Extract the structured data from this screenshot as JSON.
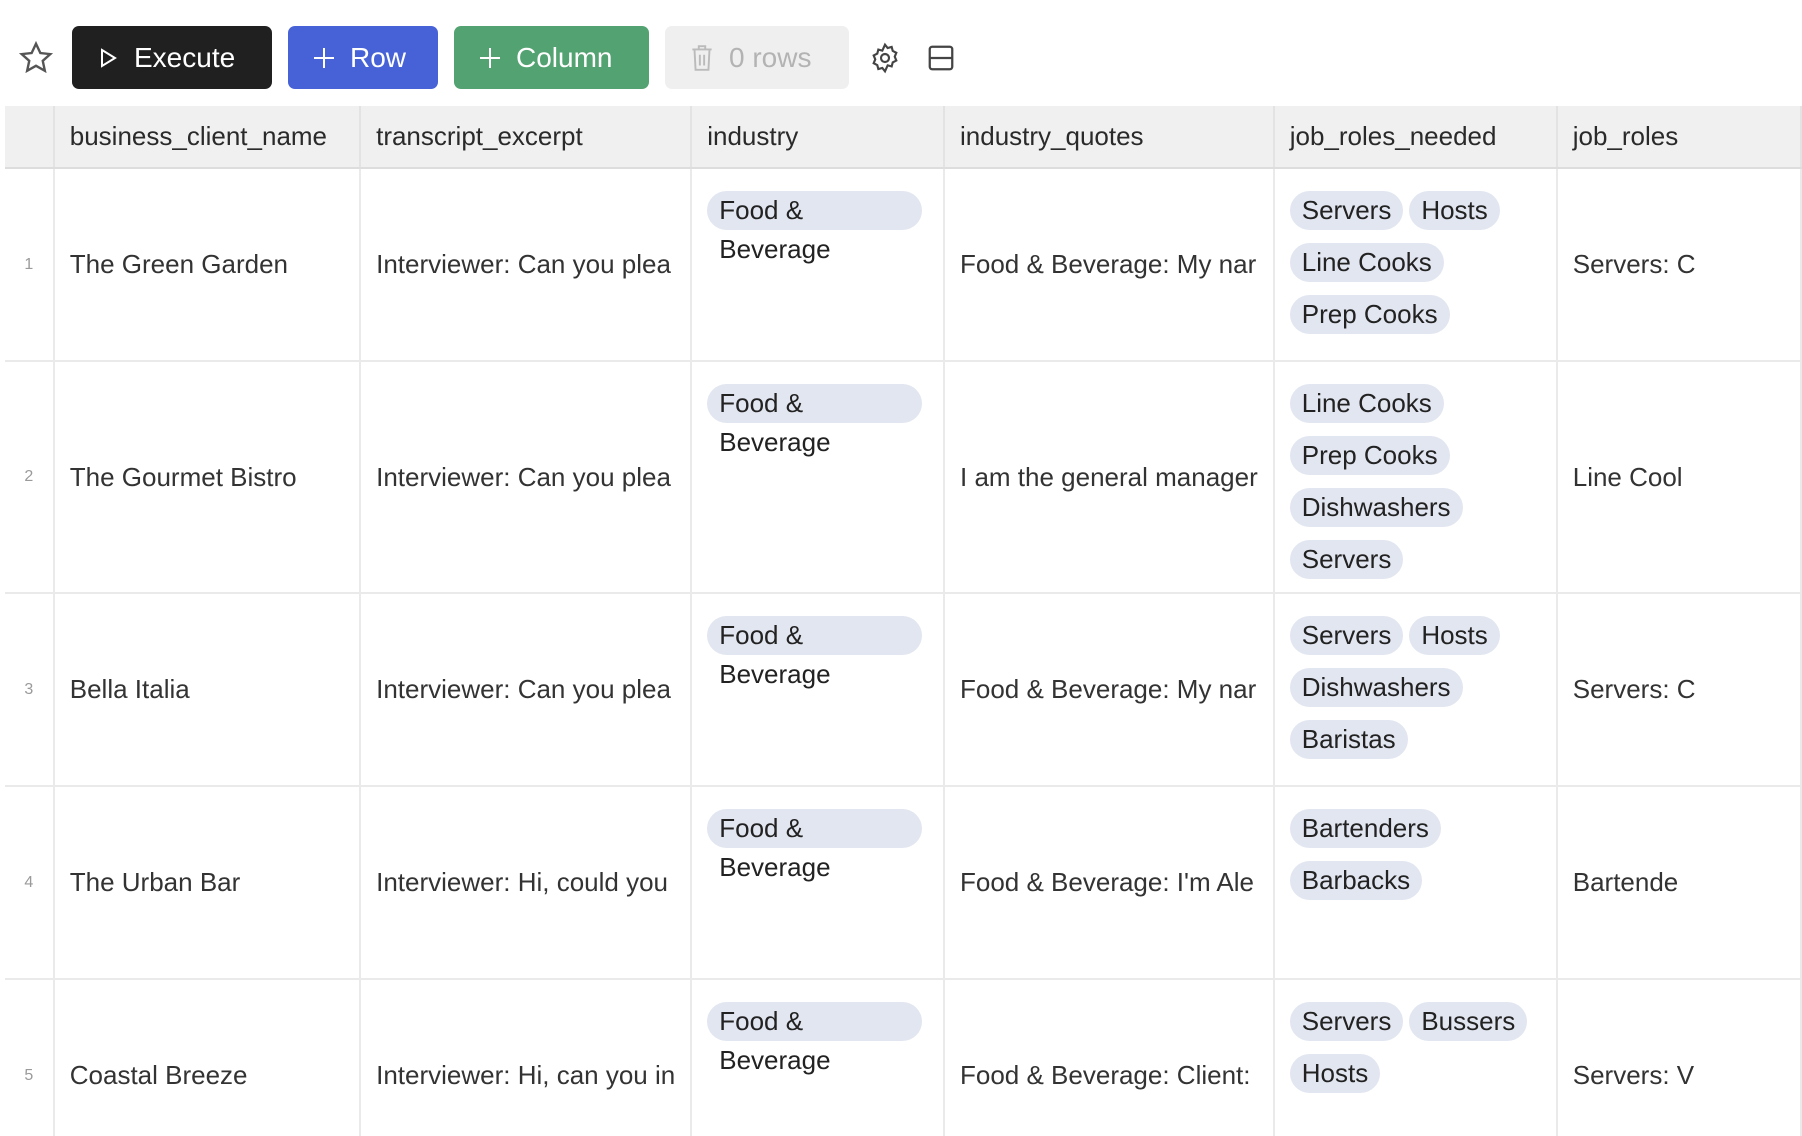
{
  "toolbar": {
    "execute_label": "Execute",
    "row_label": "Row",
    "column_label": "Column",
    "delete_label": "0 rows"
  },
  "columns": [
    "business_client_name",
    "transcript_excerpt",
    "industry",
    "industry_quotes",
    "job_roles_needed",
    "job_roles"
  ],
  "rows": [
    {
      "num": "1",
      "name": "The Green Garden",
      "transcript": "Interviewer: Can you plea",
      "industry": [
        "Food & Beverage"
      ],
      "quotes": "Food & Beverage: My nar",
      "roles": [
        "Servers",
        "Hosts",
        "Line Cooks",
        "Prep Cooks"
      ],
      "roles_detail": "Servers: C"
    },
    {
      "num": "2",
      "name": "The Gourmet Bistro",
      "transcript": "Interviewer: Can you plea",
      "industry": [
        "Food & Beverage"
      ],
      "quotes": "I am the general manager",
      "roles": [
        "Line Cooks",
        "Prep Cooks",
        "Dishwashers",
        "Servers"
      ],
      "roles_detail": "Line Cool"
    },
    {
      "num": "3",
      "name": "Bella Italia",
      "transcript": "Interviewer: Can you plea",
      "industry": [
        "Food & Beverage"
      ],
      "quotes": "Food & Beverage: My nar",
      "roles": [
        "Servers",
        "Hosts",
        "Dishwashers",
        "Baristas"
      ],
      "roles_detail": "Servers: C"
    },
    {
      "num": "4",
      "name": "The Urban Bar",
      "transcript": "Interviewer: Hi, could you",
      "industry": [
        "Food & Beverage"
      ],
      "quotes": "Food & Beverage: I'm Ale",
      "roles": [
        "Bartenders",
        "Barbacks"
      ],
      "roles_detail": "Bartende"
    },
    {
      "num": "5",
      "name": "Coastal Breeze",
      "transcript": "Interviewer: Hi, can you in",
      "industry": [
        "Food & Beverage"
      ],
      "quotes": "Food & Beverage: Client:",
      "roles": [
        "Servers",
        "Bussers",
        "Hosts"
      ],
      "roles_detail": "Servers: V"
    }
  ]
}
